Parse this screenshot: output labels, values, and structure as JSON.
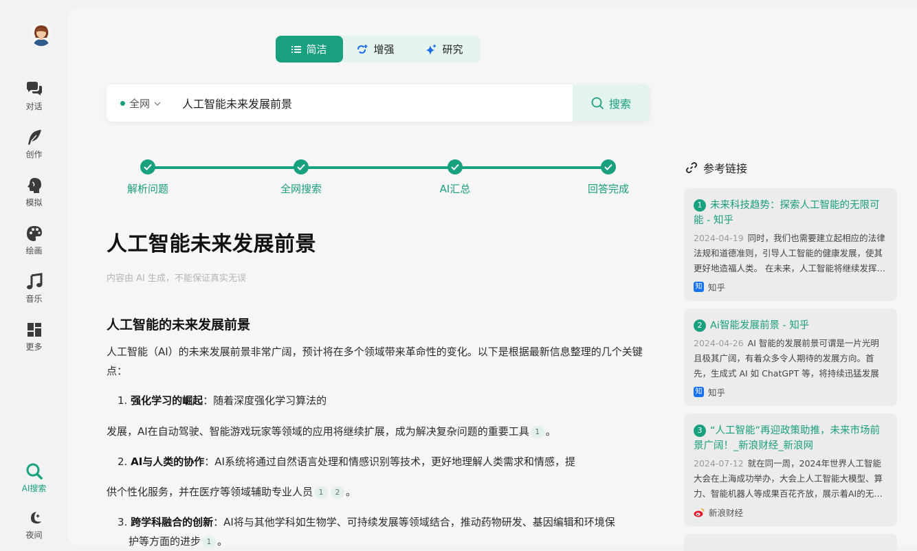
{
  "sidebar": {
    "items": [
      {
        "label": "对话",
        "icon": "chat-bubbles-icon"
      },
      {
        "label": "创作",
        "icon": "feather-icon"
      },
      {
        "label": "模拟",
        "icon": "head-icon"
      },
      {
        "label": "绘画",
        "icon": "palette-icon"
      },
      {
        "label": "音乐",
        "icon": "music-note-icon"
      },
      {
        "label": "更多",
        "icon": "grid-icon"
      },
      {
        "label": "AI搜索",
        "icon": "search-icon"
      },
      {
        "label": "夜间",
        "icon": "moon-icon"
      }
    ]
  },
  "modes": {
    "simple": "简洁",
    "enhanced": "增强",
    "research": "研究"
  },
  "search": {
    "scope": "全网",
    "query": "人工智能未来发展前景",
    "button": "搜索"
  },
  "steps": [
    "解析问题",
    "全网搜索",
    "AI汇总",
    "回答完成"
  ],
  "article": {
    "title": "人工智能未来发展前景",
    "disclaimer": "内容由 AI 生成，不能保证真实无误",
    "heading": "人工智能的未来发展前景",
    "intro": "人工智能（AI）的未来发展前景非常广阔，预计将在多个领域带来革命性的变化。以下是根据最新信息整理的几个关键点：",
    "points": [
      {
        "num": "1.",
        "title": "强化学习的崛起",
        "text1": "：随着深度强化学习算法的",
        "text2": "发展，AI在自动驾驶、智能游戏玩家等领域的应用将继续扩展，成为解决复杂问题的重要工具",
        "cites": [
          "1"
        ]
      },
      {
        "num": "2.",
        "title": "AI与人类的协作",
        "text1": "：AI系统将通过自然语言处理和情感识别等技术，更好地理解人类需求和情感，提",
        "text2": "供个性化服务，并在医疗等领域辅助专业人员",
        "cites": [
          "1",
          "2"
        ]
      },
      {
        "num": "3.",
        "title": "跨学科融合的创新",
        "text1": "：AI将与其他学科如生物学、可持续发展等领域结合，推动药物研发、基因编辑和环境保",
        "text2": "护等方面的进步",
        "cites": [
          "1"
        ]
      }
    ],
    "period": "。"
  },
  "references": {
    "heading": "参考链接",
    "items": [
      {
        "num": "1",
        "title": "未来科技趋势：探索人工智能的无限可能 - 知乎",
        "date": "2024-04-19",
        "snippet": "同时，我们也需要建立起相应的法律法规和道德准则，引导人工智能的健康发展，使其更好地造福人类。 在未来，人工智能将继续发挥重要作用",
        "source": "知乎",
        "source_icon": "知"
      },
      {
        "num": "2",
        "title": "Ai智能发展前景 - 知乎",
        "date": "2024-04-26",
        "snippet": "AI 智能的发展前景可谓是一片光明且极其广阔，有着众多令人期待的发展方向。首先，生成式 AI 如 ChatGPT 等，将持续迅猛发展",
        "source": "知乎",
        "source_icon": "知"
      },
      {
        "num": "3",
        "title": "“人工智能”再迎政策助推，未来市场前景广阔！_新浪财经_新浪网",
        "date": "2024-07-12",
        "snippet": "就在同一周，2024年世界人工智能大会在上海成功举办，大会上人工智能大模型、算力、智能机器人等成果百花齐放，展示着AI的无限可能",
        "source": "新浪财经",
        "source_icon": "weibo-icon"
      }
    ]
  },
  "colors": {
    "accent": "#18a07f",
    "accent_light": "#e3f3ee"
  }
}
